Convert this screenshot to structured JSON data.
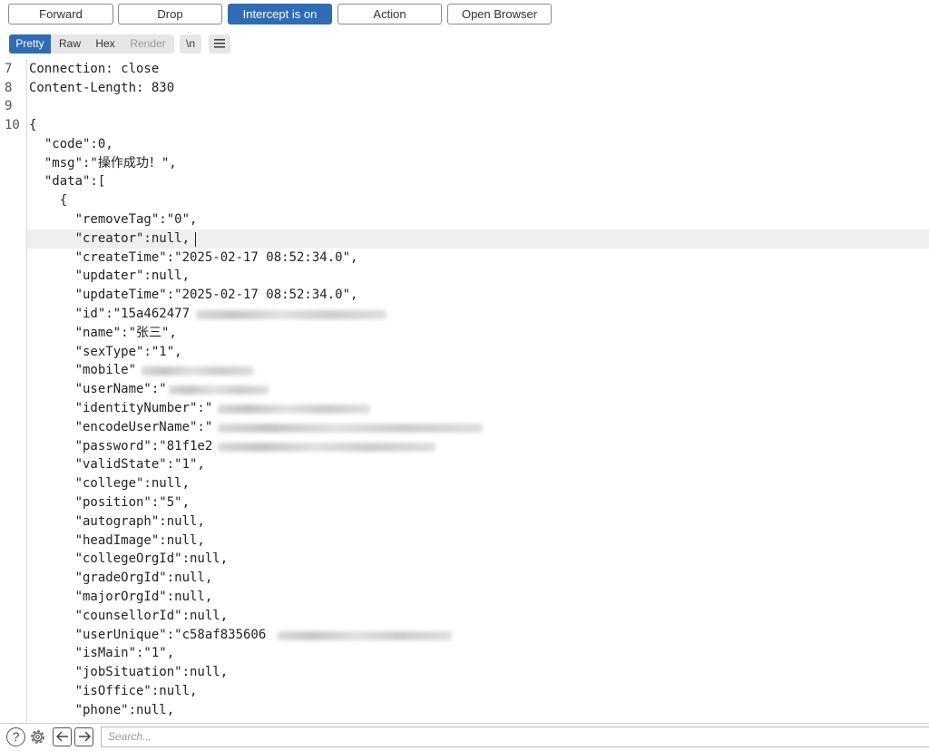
{
  "toolbar": {
    "buttons": [
      {
        "label": "Forward"
      },
      {
        "label": "Drop"
      },
      {
        "label": "Intercept is on"
      },
      {
        "label": "Action"
      },
      {
        "label": "Open Browser"
      }
    ]
  },
  "view_tabs": {
    "pretty": "Pretty",
    "raw": "Raw",
    "hex": "Hex",
    "render": "Render",
    "newline_toggle": "\\n",
    "menu_icon": "hamburger-icon"
  },
  "editor": {
    "lines": [
      {
        "num": "7",
        "text": "Connection: close"
      },
      {
        "num": "8",
        "text": "Content-Length: 830"
      },
      {
        "num": "9",
        "text": ""
      },
      {
        "num": "10",
        "text": "{"
      },
      {
        "num": "",
        "text": "  \"code\":0,"
      },
      {
        "num": "",
        "text": "  \"msg\":\"操作成功！\","
      },
      {
        "num": "",
        "text": "  \"data\":["
      },
      {
        "num": "",
        "text": "    {"
      },
      {
        "num": "",
        "text": "      \"removeTag\":\"0\","
      },
      {
        "num": "",
        "text": "      \"creator\":null,"
      },
      {
        "num": "",
        "text": "      \"createTime\":\"2025-02-17 08:52:34.0\","
      },
      {
        "num": "",
        "text": "      \"updater\":null,"
      },
      {
        "num": "",
        "text": "      \"updateTime\":\"2025-02-17 08:52:34.0\","
      },
      {
        "num": "",
        "text": "      \"id\":\"15a462477"
      },
      {
        "num": "",
        "text": "      \"name\":\"张三\","
      },
      {
        "num": "",
        "text": "      \"sexType\":\"1\","
      },
      {
        "num": "",
        "text": "      \"mobile\""
      },
      {
        "num": "",
        "text": "      \"userName\":\""
      },
      {
        "num": "",
        "text": "      \"identityNumber\":\""
      },
      {
        "num": "",
        "text": "      \"encodeUserName\":\""
      },
      {
        "num": "",
        "text": "      \"password\":\"81f1e2"
      },
      {
        "num": "",
        "text": "      \"validState\":\"1\","
      },
      {
        "num": "",
        "text": "      \"college\":null,"
      },
      {
        "num": "",
        "text": "      \"position\":\"5\","
      },
      {
        "num": "",
        "text": "      \"autograph\":null,"
      },
      {
        "num": "",
        "text": "      \"headImage\":null,"
      },
      {
        "num": "",
        "text": "      \"collegeOrgId\":null,"
      },
      {
        "num": "",
        "text": "      \"gradeOrgId\":null,"
      },
      {
        "num": "",
        "text": "      \"majorOrgId\":null,"
      },
      {
        "num": "",
        "text": "      \"counsellorId\":null,"
      },
      {
        "num": "",
        "text": "      \"userUnique\":\"c58af835606"
      },
      {
        "num": "",
        "text": "      \"isMain\":\"1\","
      },
      {
        "num": "",
        "text": "      \"jobSituation\":null,"
      },
      {
        "num": "",
        "text": "      \"isOffice\":null,"
      },
      {
        "num": "",
        "text": "      \"phone\":null,"
      }
    ]
  },
  "statusbar": {
    "help_icon": "help-icon",
    "settings_icon": "gear-icon",
    "back_icon": "arrow-left-icon",
    "forward_icon": "arrow-right-icon",
    "search_placeholder": "Search..."
  },
  "colors": {
    "accent": "#2f6cb5",
    "current_line": "#efefef"
  }
}
